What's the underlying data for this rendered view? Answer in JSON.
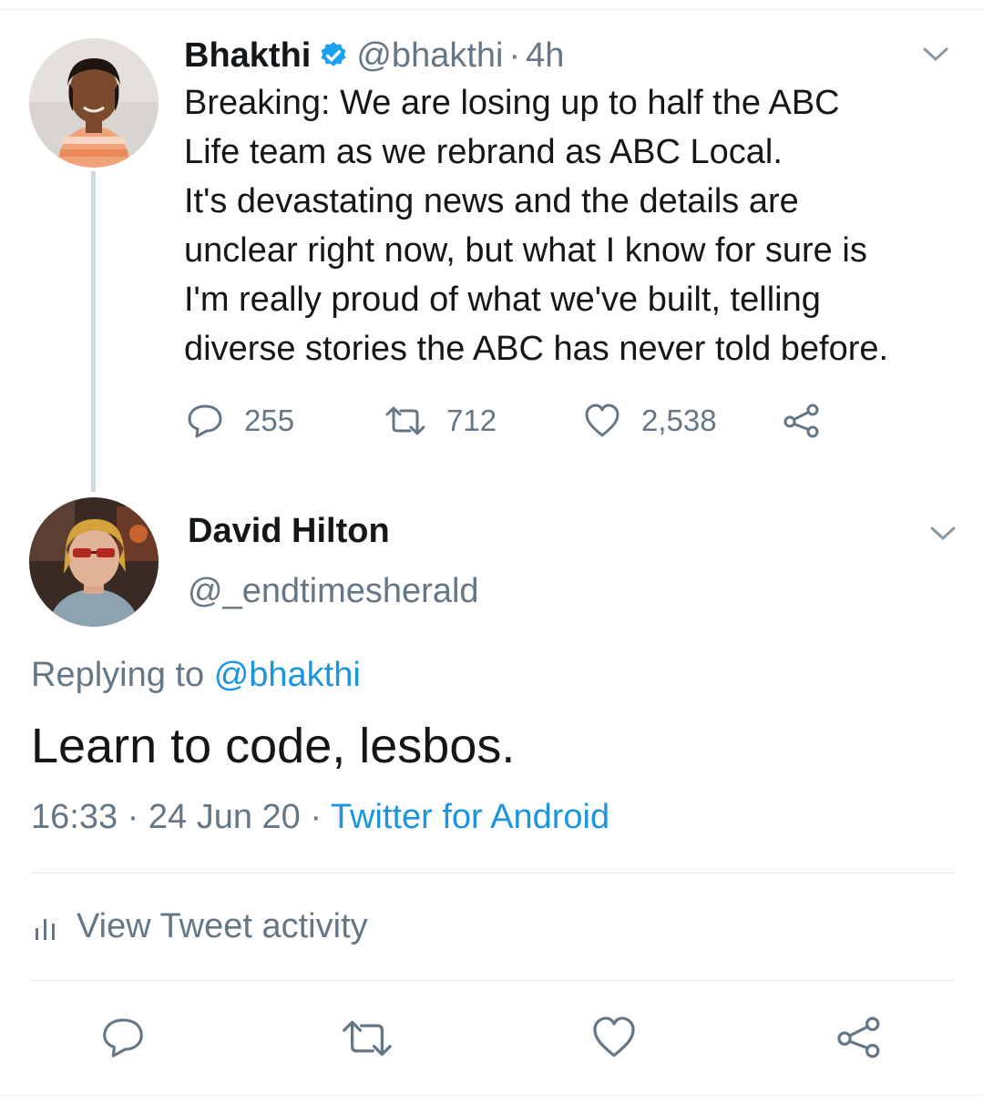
{
  "colors": {
    "link": "#1b95e0",
    "secondary": "#657786",
    "verified": "#1da1f2",
    "text": "#14171a"
  },
  "original_tweet": {
    "author_name": "Bhakthi",
    "verified": true,
    "handle": "@bhakthi",
    "separator": "·",
    "time_ago": "4h",
    "lines": [
      "Breaking: We are losing up to half the ABC",
      "Life team as we rebrand as ABC Local.",
      "It's devastating news and the details are",
      "unclear right now, but what I know for sure is",
      "I'm really proud of what we've built, telling",
      "diverse stories the ABC has never told before."
    ],
    "stats": {
      "replies": "255",
      "retweets": "712",
      "likes": "2,538"
    }
  },
  "reply_tweet": {
    "author_name": "David Hilton",
    "handle": "@_endtimesherald",
    "replying_prefix": "Replying to",
    "replying_to": "@bhakthi",
    "text": "Learn to code, lesbos.",
    "time": "16:33",
    "separator": "·",
    "date": "24 Jun 20",
    "source": "Twitter for Android"
  },
  "activity_label": "View Tweet activity",
  "icons": [
    "reply-icon",
    "retweet-icon",
    "like-icon",
    "share-icon",
    "chevron-down-icon",
    "verified-badge-icon",
    "bar-chart-icon"
  ]
}
